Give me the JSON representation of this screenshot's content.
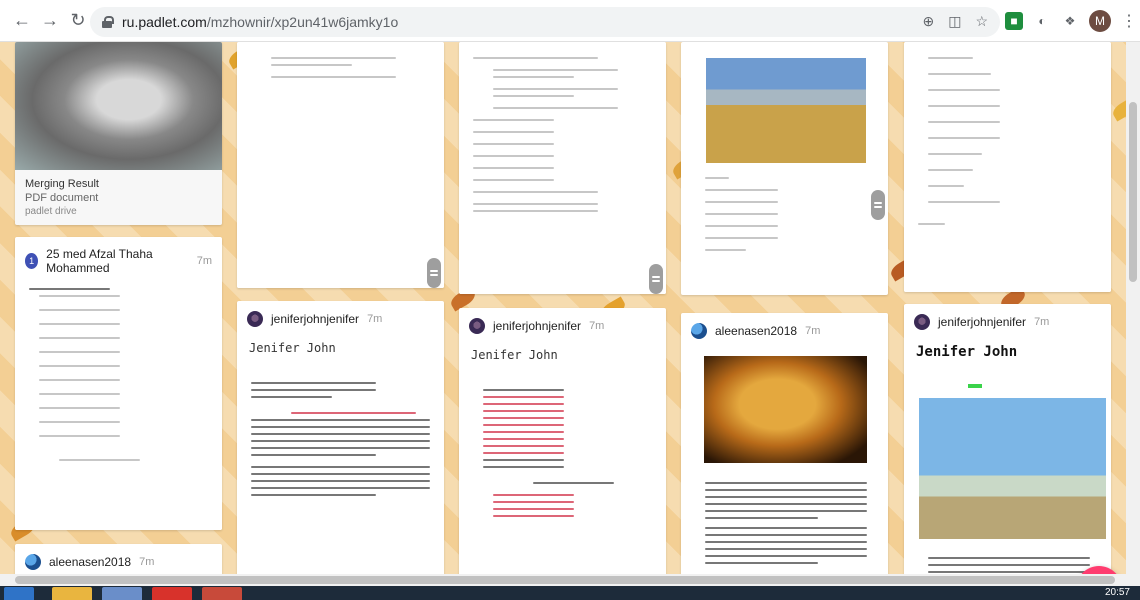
{
  "browser": {
    "url_host": "ru.padlet.com",
    "url_path": "/mzhownir/xp2un41w6jamky1o",
    "avatar_letter": "M"
  },
  "cards": {
    "merging": {
      "title": "Merging Result",
      "subtitle": "PDF document",
      "source": "padlet drive"
    },
    "afzal": {
      "badge": "1",
      "author": "25 med Afzal Thaha Mohammed",
      "time": "7m"
    },
    "aleena_bottom": {
      "author": "aleenasen2018",
      "time": "7m"
    },
    "jenifer1": {
      "author": "jeniferjohnjenifer",
      "time": "7m",
      "title": "Jenifer John"
    },
    "jenifer2": {
      "author": "jeniferjohnjenifer",
      "time": "7m",
      "title": "Jenifer John"
    },
    "aleena_lion": {
      "author": "aleenasen2018",
      "time": "7m"
    },
    "jenifer3": {
      "author": "jeniferjohnjenifer",
      "time": "7m",
      "title": "Jenifer John"
    }
  },
  "fab_label": "+",
  "taskbar": {
    "time": "20:57"
  },
  "colors": {
    "fab": "#ff3c6f",
    "board_bg": "#f6dcb0"
  }
}
